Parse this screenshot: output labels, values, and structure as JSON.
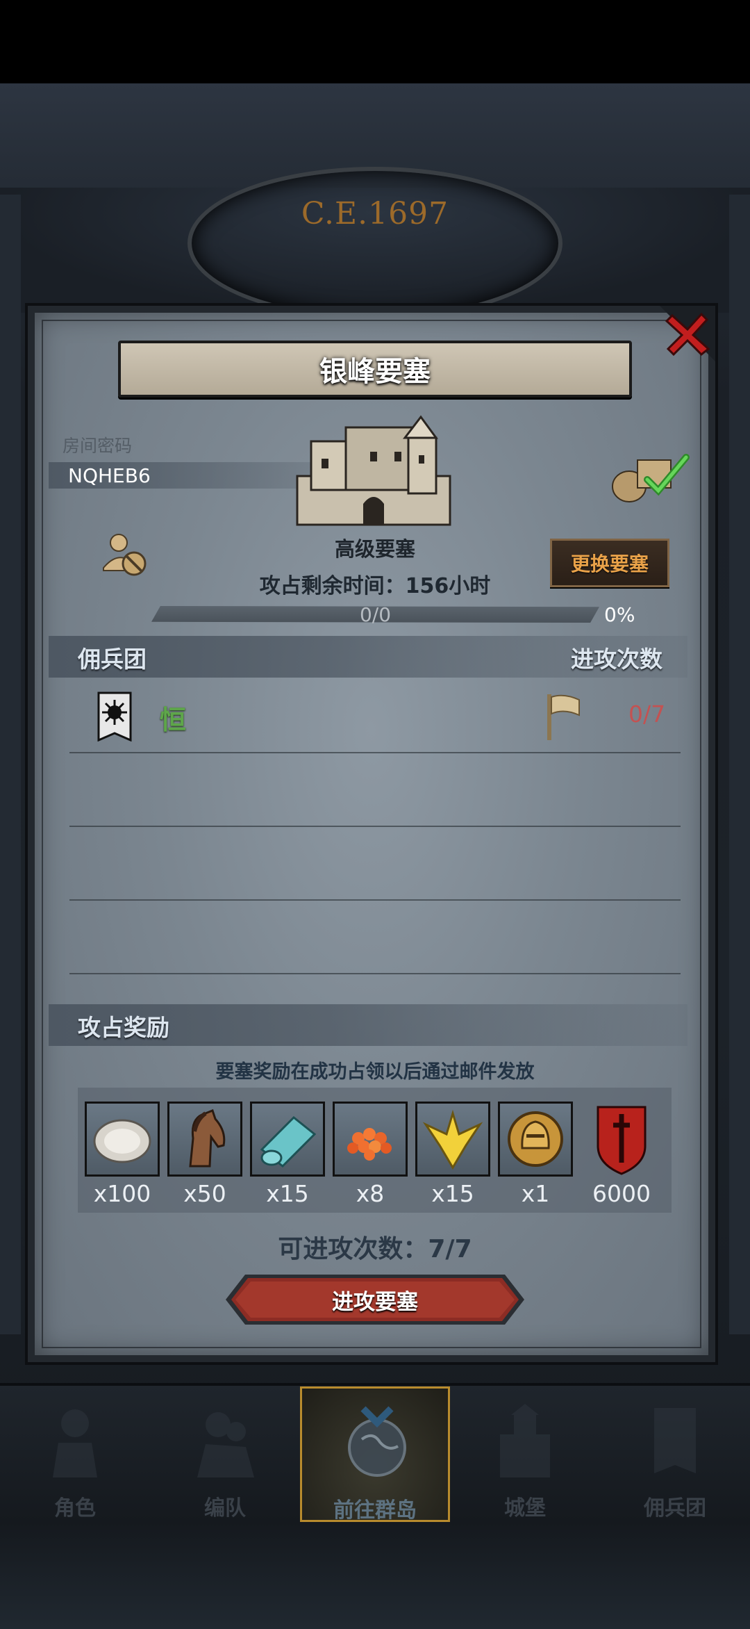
{
  "header": {
    "era": "C.E.1697"
  },
  "modal": {
    "title": "银峰要塞",
    "room_label": "房间密码",
    "room_code": "NQHEB6",
    "fortress_type": "高级要塞",
    "time_left": "攻占剩余时间：156小时",
    "change_button": "更换要塞",
    "progress": {
      "text": "0/0",
      "percent": "0%",
      "fraction": 0
    },
    "mercenary_section": "佣兵团",
    "attack_count_section": "进攻次数",
    "mercenary": {
      "name": "恒",
      "attacks": "0/7"
    },
    "reward_section": "攻占奖励",
    "reward_note": "要塞奖励在成功占领以后通过邮件发放",
    "rewards": [
      {
        "icon": "oyster-icon",
        "qty": "x100"
      },
      {
        "icon": "horse-icon",
        "qty": "x50"
      },
      {
        "icon": "cloth-icon",
        "qty": "x15"
      },
      {
        "icon": "roe-icon",
        "qty": "x8"
      },
      {
        "icon": "gold-crest-icon",
        "qty": "x15"
      },
      {
        "icon": "helmet-coin-icon",
        "qty": "x1"
      },
      {
        "icon": "sword-shield-icon",
        "qty": "6000"
      }
    ],
    "available_attacks": "可进攻次数：7/7",
    "attack_button": "进攻要塞"
  },
  "nav": [
    {
      "label": "角色",
      "icon": "knight-icon"
    },
    {
      "label": "编队",
      "icon": "troops-icon"
    },
    {
      "label": "前往群岛",
      "icon": "globe-icon"
    },
    {
      "label": "城堡",
      "icon": "castle-icon"
    },
    {
      "label": "佣兵团",
      "icon": "mercenary-icon"
    }
  ],
  "colors": {
    "accent": "#e9a249",
    "danger": "#c35252",
    "success": "#5ea64a",
    "active_nav_border": "#b88b2d"
  }
}
